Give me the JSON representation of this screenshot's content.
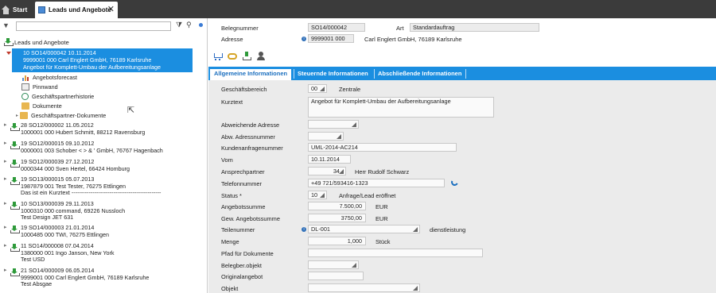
{
  "top_tabs": {
    "start_label": "Start",
    "active_label": "Leads und Angebote",
    "close_glyph": "✕"
  },
  "left": {
    "search": {
      "value": "",
      "placeholder": ""
    },
    "root_label": "Leads und Angebote",
    "selected": {
      "line1": "10 SO14/000042 10.11.2014",
      "line2": "9999001 000 Carl Englert GmbH, 76189 Karlsruhe",
      "line3": "Angebot für Komplett-Umbau der Aufbereitungsanlage"
    },
    "children": [
      {
        "label": "Angebotsforecast",
        "icon": "chart-icon"
      },
      {
        "label": "Pinnwand",
        "icon": "pinboard-icon"
      },
      {
        "label": "Geschäftspartnerhistorie",
        "icon": "history-icon"
      },
      {
        "label": "Dokumente",
        "icon": "folder-icon"
      },
      {
        "label": "Geschäftspartner-Dokumente",
        "icon": "folder-icon"
      }
    ],
    "items": [
      {
        "line1": "28 SO12/000002 11.05.2012",
        "line2": "1000001 000 Hubert Schmitt, 88212 Ravensburg",
        "line3": ""
      },
      {
        "line1": "19 SO12/000015 09.10.2012",
        "line2": "0000001 003 Schober < > & ' GmbH, 76767 Hagenbach",
        "line3": ""
      },
      {
        "line1": "19 SO12/000039 27.12.2012",
        "line2": "0000344 000 Sven Hertel, 66424 Homburg",
        "line3": ""
      },
      {
        "line1": "19 SO13/000015 05.07.2013",
        "line2": "1987879 001 Test Tester, 76275 Ettlingen",
        "line3": "Das ist ein Kurztext -----------------------------------------------"
      },
      {
        "line1": "10 SO13/000039 29.11.2013",
        "line2": "1000310 000 command, 69226 Nussloch",
        "line3": "Test Design JET 631"
      },
      {
        "line1": "19 SO14/000003 21.01.2014",
        "line2": "1000485 000 TWI, 76275 Ettlingen",
        "line3": ""
      },
      {
        "line1": "11 SO14/000008 07.04.2014",
        "line2": "1380000 001 Ingo Janson, New York",
        "line3": "Test USD"
      },
      {
        "line1": "21 SO14/000009 06.05.2014",
        "line2": "9999001 000 Carl Englert GmbH, 76189 Karlsruhe",
        "line3": "Test Absgae"
      }
    ]
  },
  "header": {
    "belegnummer_label": "Belegnummer",
    "belegnummer_value": "SO14/000042",
    "art_label": "Art",
    "art_value": "Standardauftrag",
    "adresse_label": "Adresse",
    "adresse_value": "9999001 000",
    "adresse_name": "Carl Englert GmbH, 76189 Karlsruhe",
    "info_glyph": "i"
  },
  "tabs": [
    "Allgemeine Informationen",
    "Steuernde Informationen",
    "Abschließende Informationen"
  ],
  "form": {
    "geschaeftsbereich": {
      "label": "Geschäftsbereich",
      "value": "00",
      "text": "Zentrale"
    },
    "kurztext": {
      "label": "Kurztext",
      "value": "Angebot für Komplett-Umbau der Aufbereitungsanlage"
    },
    "abw_adresse": {
      "label": "Abweichende Adresse",
      "value": ""
    },
    "abw_adressnummer": {
      "label": "Abw. Adressnummer",
      "value": ""
    },
    "kundenanfragenummer": {
      "label": "Kundenanfragenummer",
      "value": "UML-2014-AC214"
    },
    "vom": {
      "label": "Vom",
      "value": "10.11.2014"
    },
    "ansprechpartner": {
      "label": "Ansprechpartner",
      "value": "34",
      "text": "Herr Rudolf Schwarz"
    },
    "telefonnummer": {
      "label": "Telefonnummer",
      "value": "+49 721/593416-1323"
    },
    "status": {
      "label": "Status *",
      "value": "10",
      "text": "Anfrage/Lead eröffnet"
    },
    "angebotssumme": {
      "label": "Angebotssumme",
      "value": "7.500,00",
      "currency": "EUR"
    },
    "gew_angebotssumme": {
      "label": "Gew. Angebotssumme",
      "value": "3750,00",
      "currency": "EUR"
    },
    "teilenummer": {
      "label": "Teilenummer",
      "value": "DL-001",
      "text": "dienstleistung"
    },
    "menge": {
      "label": "Menge",
      "value": "1,000",
      "unit": "Stück"
    },
    "pfad": {
      "label": "Pfad für Dokumente",
      "value": ""
    },
    "belegber_objekt": {
      "label": "Belegber.objekt",
      "value": ""
    },
    "originalangebot": {
      "label": "Originalangebot",
      "value": ""
    },
    "objekt": {
      "label": "Objekt",
      "value": ""
    }
  },
  "colors": {
    "accent": "#1b8ee0",
    "topbar": "#3b3b3b",
    "form_bg": "#ebebeb"
  }
}
